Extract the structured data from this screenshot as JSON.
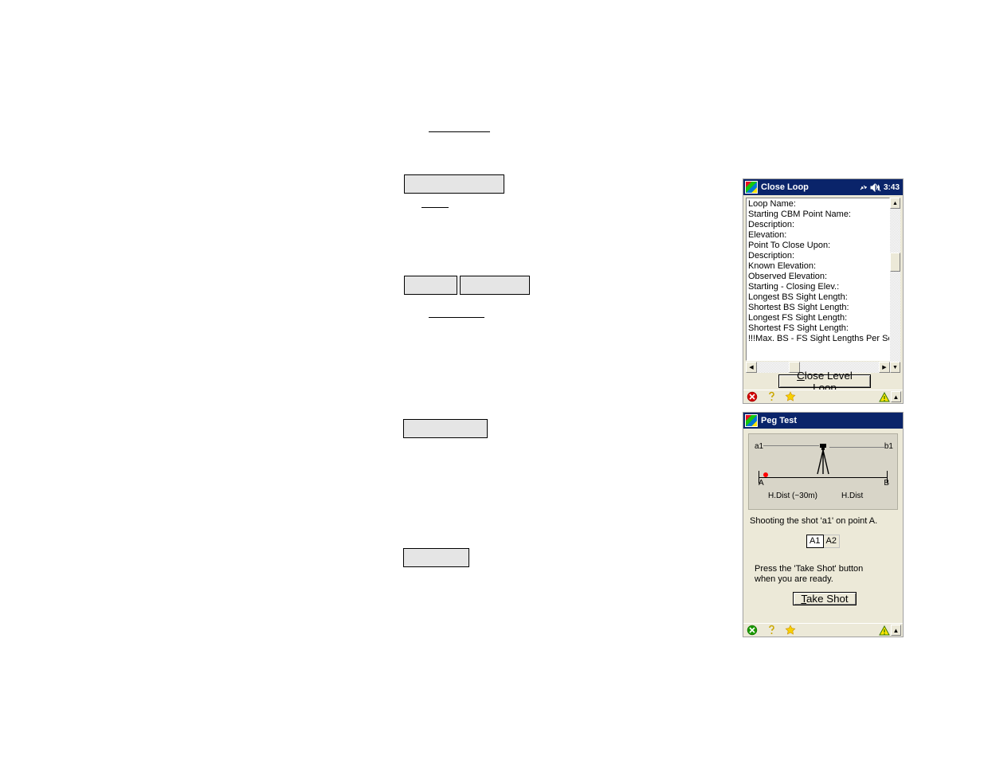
{
  "left_blocks": {},
  "close_loop": {
    "title": "Close Loop",
    "time": "3:43",
    "lines": [
      "Loop Name:",
      "Starting CBM Point Name:",
      "Description:",
      " Elevation:",
      "Point To Close Upon:",
      " Description:",
      " Known Elevation:",
      " Observed Elevation:",
      "Starting - Closing Elev.:",
      "Longest BS Sight Length:",
      "Shortest BS Sight Length:",
      "Longest FS Sight Length:",
      "Shortest FS Sight Length:",
      "!!!Max. BS - FS Sight Lengths Per Setu"
    ],
    "button": "Close Level Loop",
    "button_underline": "C"
  },
  "peg_test": {
    "title": "Peg Test",
    "shot_a": "a1",
    "shot_b": "b1",
    "ptA": "A",
    "ptB": "B",
    "hdist_left": "H.Dist (~30m)",
    "hdist_right": "H.Dist",
    "instruction": "Shooting the shot 'a1' on point A.",
    "tab_active": "A1",
    "tab_inactive": "A2",
    "hint": "Press the 'Take Shot' button when you are ready.",
    "button": "Take Shot",
    "button_underline": "T"
  }
}
